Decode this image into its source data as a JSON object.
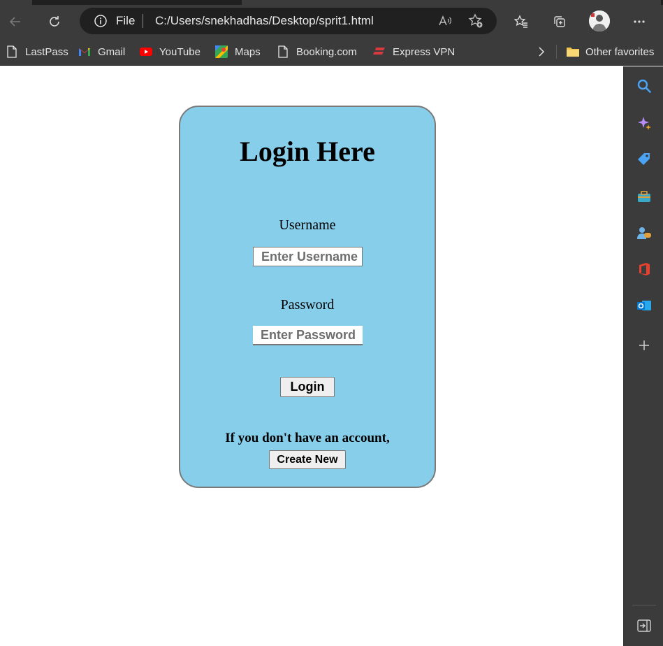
{
  "browser": {
    "file_label": "File",
    "url": "C:/Users/snekhadhas/Desktop/sprit1.html",
    "icons": [
      "back-icon",
      "refresh-icon",
      "info-icon",
      "read-aloud-icon",
      "add-favorite-icon",
      "favorites-icon",
      "collections-icon",
      "profile-avatar",
      "more-icon"
    ]
  },
  "favorites": {
    "items": [
      {
        "label": "LastPass",
        "icon": "page-icon"
      },
      {
        "label": "Gmail",
        "icon": "gmail-icon"
      },
      {
        "label": "YouTube",
        "icon": "youtube-icon"
      },
      {
        "label": "Maps",
        "icon": "maps-icon"
      },
      {
        "label": "Booking.com",
        "icon": "page-icon"
      },
      {
        "label": "Express VPN",
        "icon": "expressvpn-icon"
      }
    ],
    "other_label": "Other favorites"
  },
  "sidebar": {
    "icons": [
      "search-icon",
      "copilot-icon",
      "shopping-icon",
      "tools-icon",
      "games-icon",
      "office-icon",
      "outlook-icon",
      "add-icon",
      "hide-sidebar-icon"
    ]
  },
  "login": {
    "title": "Login Here",
    "username_label": "Username",
    "username_placeholder": "Enter Username",
    "password_label": "Password",
    "password_placeholder": "Enter Password",
    "login_button": "Login",
    "signup_note": "If you don't have an account,",
    "create_button": "Create New"
  },
  "colors": {
    "card_bg": "#87ceeb",
    "chrome_bg": "#3b3b3b"
  }
}
